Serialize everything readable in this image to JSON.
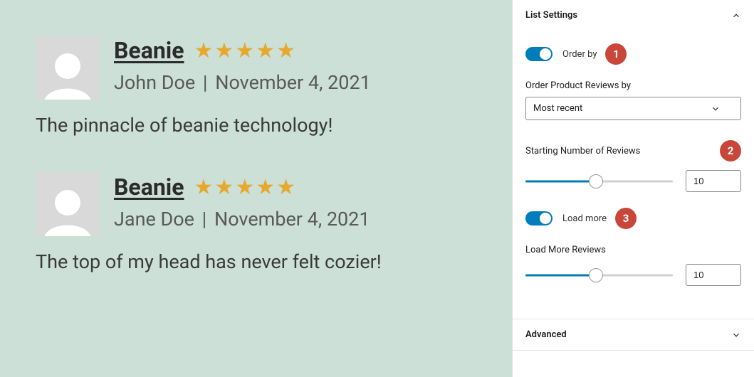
{
  "reviews": [
    {
      "product": "Beanie",
      "stars": 5,
      "author": "John Doe",
      "date": "November 4, 2021",
      "body": "The pinnacle of beanie technology!"
    },
    {
      "product": "Beanie",
      "stars": 5,
      "author": "Jane Doe",
      "date": "November 4, 2021",
      "body": "The top of my head has never felt cozier!"
    }
  ],
  "sidebar": {
    "listSettings": {
      "title": "List Settings",
      "orderByToggle": {
        "label": "Order by",
        "on": true
      },
      "orderLabel": "Order Product Reviews by",
      "orderSelected": "Most recent",
      "startingLabel": "Starting Number of Reviews",
      "startingValue": "10",
      "loadMoreToggle": {
        "label": "Load more",
        "on": true
      },
      "loadMoreLabel": "Load More Reviews",
      "loadMoreValue": "10"
    },
    "advanced": {
      "title": "Advanced"
    }
  },
  "badges": {
    "one": "1",
    "two": "2",
    "three": "3"
  }
}
